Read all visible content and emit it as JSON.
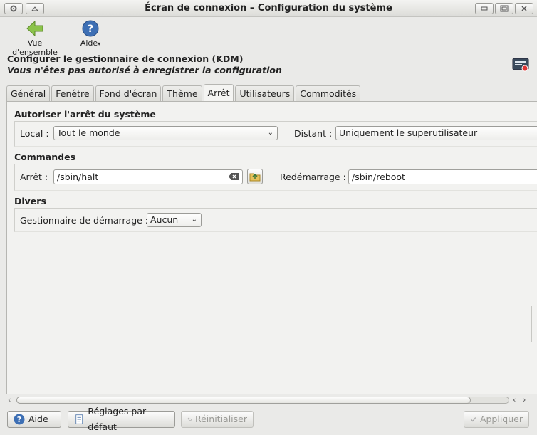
{
  "window": {
    "title": "Écran de connexion – Configuration du système"
  },
  "toolbar": {
    "overview_label": "Vue d'ensemble",
    "help_label": "Aide"
  },
  "header": {
    "title": "Configurer le gestionnaire de connexion (KDM)",
    "subtitle": "Vous n'êtes pas autorisé à enregistrer la configuration"
  },
  "tabs": [
    "Général",
    "Fenêtre",
    "Fond d'écran",
    "Thème",
    "Arrêt",
    "Utilisateurs",
    "Commodités"
  ],
  "active_tab": "Arrêt",
  "shutdown": {
    "title": "Autoriser l'arrêt du système",
    "local_label": "Local :",
    "local_value": "Tout le monde",
    "remote_label": "Distant :",
    "remote_value": "Uniquement le superutilisateur"
  },
  "commands": {
    "title": "Commandes",
    "halt_label": "Arrêt :",
    "halt_value": "/sbin/halt",
    "reboot_label": "Redémarrage :",
    "reboot_value": "/sbin/reboot"
  },
  "misc": {
    "title": "Divers",
    "bootmgr_label": "Gestionnaire de démarrage :",
    "bootmgr_value": "Aucun"
  },
  "buttons": {
    "help": "Aide",
    "defaults": "Réglages par défaut",
    "reset": "Réinitialiser",
    "apply": "Appliquer"
  },
  "colors": {
    "accent_green": "#7cb342",
    "help_blue": "#3d6fb4"
  }
}
